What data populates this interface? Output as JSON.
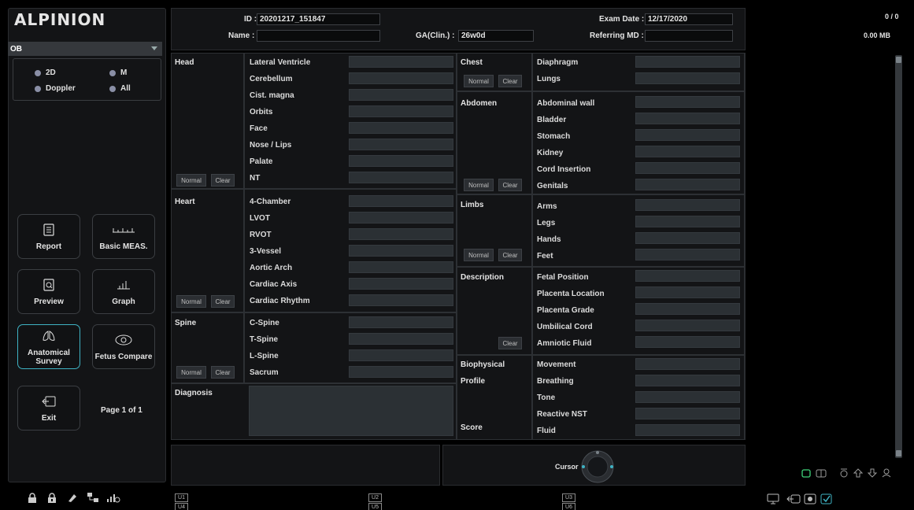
{
  "logo": "ALPINION",
  "preset": "OB",
  "modes": [
    "2D",
    "M",
    "Doppler",
    "All"
  ],
  "tiles": {
    "report": "Report",
    "basic_meas": "Basic MEAS.",
    "preview": "Preview",
    "graph": "Graph",
    "anatomical_survey": "Anatomical Survey",
    "fetus_compare": "Fetus Compare",
    "exit": "Exit"
  },
  "page_indicator": "Page 1 of 1",
  "header": {
    "id_label": "ID :",
    "id_value": "20201217_151847",
    "name_label": "Name :",
    "name_value": "",
    "ga_label": "GA(Clin.) :",
    "ga_value": "26w0d",
    "exam_date_label": "Exam Date :",
    "exam_date_value": "12/17/2020",
    "referring_md_label": "Referring MD :",
    "referring_md_value": ""
  },
  "buttons": {
    "normal": "Normal",
    "clear": "Clear"
  },
  "sections": {
    "head": {
      "title": "Head",
      "items": [
        "Lateral Ventricle",
        "Cerebellum",
        "Cist. magna",
        "Orbits",
        "Face",
        "Nose / Lips",
        "Palate",
        "NT"
      ]
    },
    "heart": {
      "title": "Heart",
      "items": [
        "4-Chamber",
        "LVOT",
        "RVOT",
        "3-Vessel",
        "Aortic Arch",
        "Cardiac Axis",
        "Cardiac Rhythm"
      ]
    },
    "spine": {
      "title": "Spine",
      "items": [
        "C-Spine",
        "T-Spine",
        "L-Spine",
        "Sacrum"
      ]
    },
    "diagnosis": {
      "title": "Diagnosis"
    },
    "chest": {
      "title": "Chest",
      "items": [
        "Diaphragm",
        "Lungs"
      ]
    },
    "abdomen": {
      "title": "Abdomen",
      "items": [
        "Abdominal wall",
        "Bladder",
        "Stomach",
        "Kidney",
        "Cord Insertion",
        "Genitals"
      ]
    },
    "limbs": {
      "title": "Limbs",
      "items": [
        "Arms",
        "Legs",
        "Hands",
        "Feet"
      ]
    },
    "description": {
      "title": "Description",
      "items": [
        "Fetal Position",
        "Placenta Location",
        "Placenta Grade",
        "Umbilical Cord",
        "Amniotic Fluid"
      ]
    },
    "biophysical": {
      "title_line1": "Biophysical",
      "title_line2": "Profile",
      "score_label": "Score",
      "items": [
        "Movement",
        "Breathing",
        "Tone",
        "Reactive NST",
        "Fluid"
      ]
    }
  },
  "cursor_label": "Cursor",
  "status": {
    "counter": "0 / 0",
    "size": "0.00 MB"
  },
  "user_keys": [
    {
      "top": "U1",
      "bottom": "U4"
    },
    {
      "top": "U2",
      "bottom": "U5"
    },
    {
      "top": "U3",
      "bottom": "U6"
    }
  ],
  "colors": {
    "accent": "#3fb3c4",
    "field": "#2b3034",
    "panel": "#131416"
  }
}
